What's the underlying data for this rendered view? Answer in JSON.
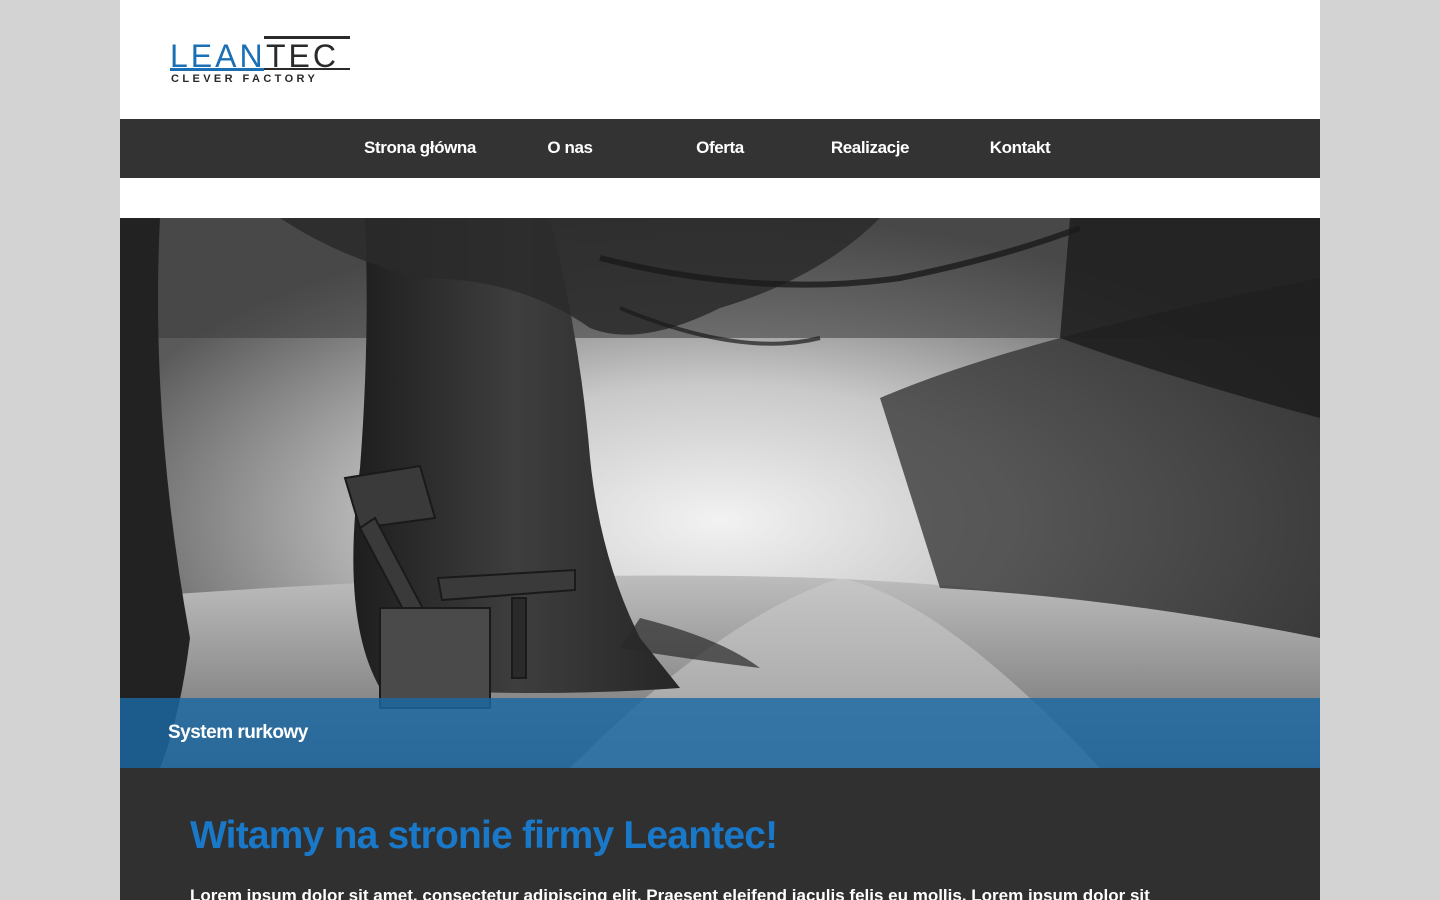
{
  "logo": {
    "word": "LEANTEC",
    "tagline": "CLEVER FACTORY",
    "colors": {
      "blue": "#1a6fb5",
      "dark": "#2a2a2a"
    }
  },
  "nav": {
    "items": [
      {
        "label": "Strona główna"
      },
      {
        "label": "O nas"
      },
      {
        "label": "Oferta"
      },
      {
        "label": "Realizacje"
      },
      {
        "label": "Kontakt"
      }
    ]
  },
  "hero": {
    "image": "foggy-park-bench-photo",
    "caption": "System rurkowy"
  },
  "content": {
    "title": "Witamy na stronie firmy Leantec!",
    "text": "Lorem ipsum dolor sit amet, consectetur adipiscing elit. Praesent eleifend iaculis felis eu mollis. Lorem ipsum dolor sit"
  },
  "colors": {
    "nav_bg": "#333333",
    "caption_bg": "#1b69a5",
    "content_bg": "#303030",
    "title": "#1a78c8",
    "outer_bg": "#d3d3d3"
  }
}
